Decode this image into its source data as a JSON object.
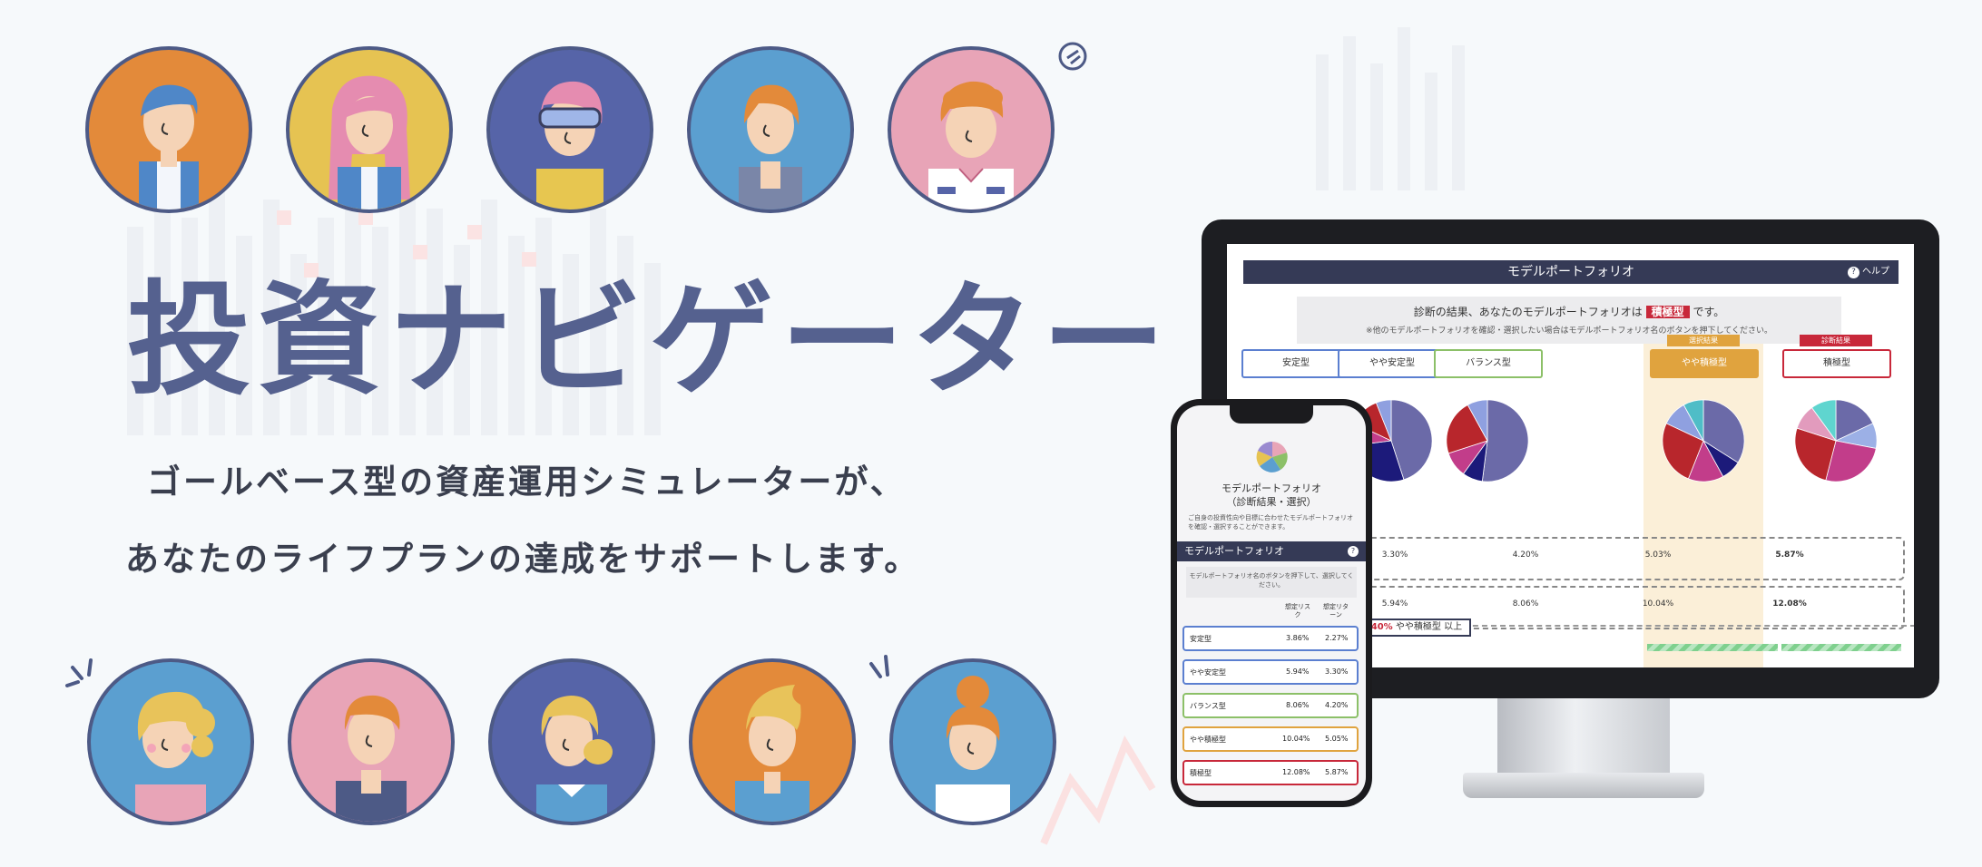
{
  "hero": {
    "title": "投資ナビゲーター",
    "subtitle_line1": "ゴールベース型の資産運用シミュレーターが、",
    "subtitle_line2": "あなたのライフプランの達成をサポートします。"
  },
  "colors": {
    "title": "#55618f",
    "orange": "#e38a3a",
    "yellow": "#e6c352",
    "navy": "#5664a8",
    "blue": "#5b9fd0",
    "pink": "#e8a4b7",
    "accent_red": "#c8283a",
    "header_dark": "#353a56"
  },
  "avatars_top": [
    {
      "bg": "orange",
      "hair": "blue-hair"
    },
    {
      "bg": "yellow",
      "hair": "pink-hair"
    },
    {
      "bg": "navy",
      "hair": "pink-hair-goggles"
    },
    {
      "bg": "blue",
      "hair": "orange-hair"
    },
    {
      "bg": "pink",
      "hair": "orange-curly-hair"
    }
  ],
  "avatars_bottom": [
    {
      "bg": "blue",
      "hair": "blonde-curly-hair"
    },
    {
      "bg": "pink",
      "hair": "orange-hair"
    },
    {
      "bg": "navy",
      "hair": "blonde-bun-hair"
    },
    {
      "bg": "orange",
      "hair": "blonde-quiff-hair"
    },
    {
      "bg": "blue",
      "hair": "orange-bun-hair"
    }
  ],
  "desktop": {
    "header": "モデルポートフォリオ",
    "help": "ヘルプ",
    "result_prefix": "診断の結果、あなたのモデルポートフォリオは",
    "result_type": "積極型",
    "result_suffix": "です。",
    "result_note": "※他のモデルポートフォリオを確認・選択したい場合はモデルポートフォリオ名のボタンを押下してください。",
    "portfolios": [
      {
        "name": "安定型",
        "border": "#5b7fd0",
        "badge": ""
      },
      {
        "name": "やや安定型",
        "border": "#5b7fd0",
        "badge": ""
      },
      {
        "name": "バランス型",
        "border": "#8cc068",
        "badge": ""
      },
      {
        "name": "やや積極型",
        "border": "#e0a33e",
        "badge": "選択結果"
      },
      {
        "name": "積極型",
        "border": "#c8283a",
        "badge": "診断結果"
      }
    ],
    "returns": [
      "3.30%",
      "4.20%",
      "5.03%",
      "5.87%"
    ],
    "risks": [
      "5.94%",
      "8.06%",
      "10.04%",
      "12.08%"
    ],
    "bottom_pct": "4.40%",
    "bottom_label": "やや積極型 以上"
  },
  "phone": {
    "title_line1": "モデルポートフォリオ",
    "title_line2": "（診断結果・選択）",
    "desc": "ご自身の投資性向や目標に合わせたモデルポートフォリオを確認・選択することができます。",
    "section": "モデルポートフォリオ",
    "note": "モデルポートフォリオ名のボタンを押下して、選択してください。",
    "col_risk": "想定リスク",
    "col_return": "想定リターン",
    "rows": [
      {
        "name": "安定型",
        "risk": "3.86%",
        "ret": "2.27%",
        "border": "#5b7fd0"
      },
      {
        "name": "やや安定型",
        "risk": "5.94%",
        "ret": "3.30%",
        "border": "#5b7fd0"
      },
      {
        "name": "バランス型",
        "risk": "8.06%",
        "ret": "4.20%",
        "border": "#8cc068"
      },
      {
        "name": "やや積極型",
        "risk": "10.04%",
        "ret": "5.05%",
        "border": "#e0a33e"
      },
      {
        "name": "積極型",
        "risk": "12.08%",
        "ret": "5.87%",
        "border": "#c8283a"
      }
    ]
  },
  "chart_data": [
    {
      "type": "pie",
      "values": [
        62,
        6,
        14,
        10,
        5,
        3
      ],
      "colors": [
        "#6b6aa8",
        "#1c1a7a",
        "#c23d8a",
        "#b8262c",
        "#8c9ad8",
        "#3c3c92"
      ]
    },
    {
      "type": "pie",
      "values": [
        45,
        28,
        9,
        12,
        6
      ],
      "colors": [
        "#6b6aa8",
        "#1c1a7a",
        "#c23d8a",
        "#b8262c",
        "#8fa0e0"
      ]
    },
    {
      "type": "pie",
      "values": [
        52,
        8,
        10,
        22,
        8
      ],
      "colors": [
        "#6b6aa8",
        "#1c1a7a",
        "#c23d8a",
        "#b8262c",
        "#8fa0e0"
      ]
    },
    {
      "type": "pie",
      "values": [
        34,
        8,
        14,
        26,
        10,
        8
      ],
      "colors": [
        "#6b6aa8",
        "#1c1a7a",
        "#c23d8a",
        "#b8262c",
        "#8fa0e0",
        "#4fbdc7"
      ]
    },
    {
      "type": "pie",
      "values": [
        18,
        10,
        26,
        26,
        10,
        10
      ],
      "colors": [
        "#6b6aa8",
        "#9cb0e6",
        "#c23d8a",
        "#b8262c",
        "#e29bbd",
        "#5fd5cf"
      ]
    }
  ]
}
